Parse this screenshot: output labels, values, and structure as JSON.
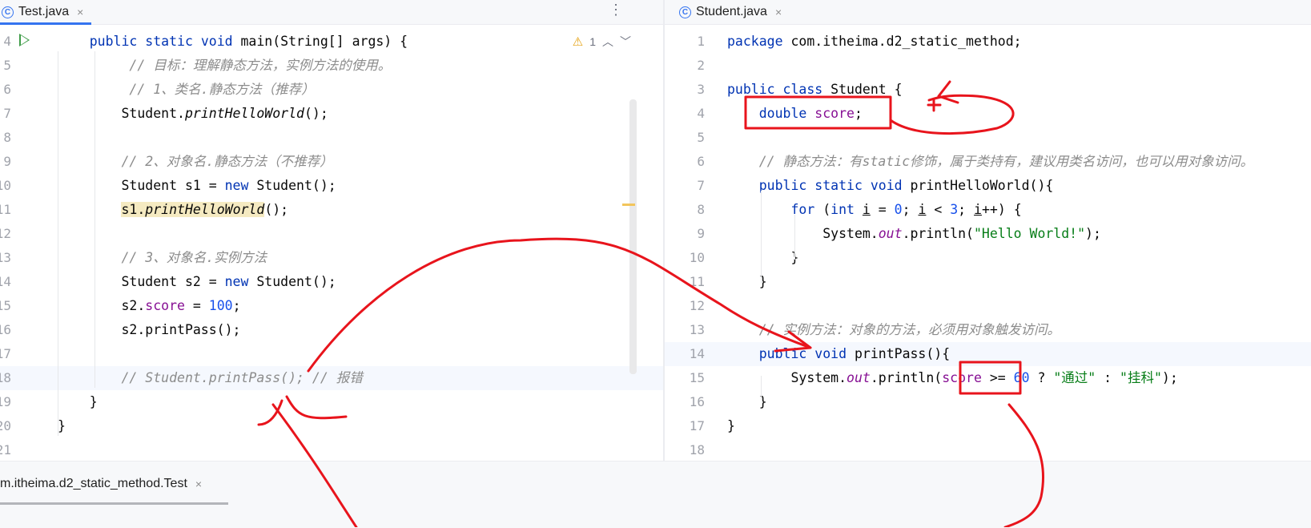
{
  "left_editor": {
    "tab_label": "Test.java",
    "class_icon": "C",
    "close_glyph": "×",
    "more_glyph": "⋮",
    "warning_count": "1",
    "warning_glyph": "⚠",
    "up_glyph": "︿",
    "down_glyph": "﹀",
    "lines": [
      {
        "num": "4",
        "html": "    <span class=\"kw\">public static void</span> main(String[] args) {"
      },
      {
        "num": "5",
        "html": "         <span class=\"cm\">// 目标：理解静态方法，实例方法的使用。</span>"
      },
      {
        "num": "6",
        "html": "         <span class=\"cm\">// 1、类名.静态方法（推荐）</span>"
      },
      {
        "num": "7",
        "html": "        Student.<span class=\"ital\">printHelloWorld</span>();"
      },
      {
        "num": "8",
        "html": ""
      },
      {
        "num": "9",
        "html": "        <span class=\"cm\">// 2、对象名.静态方法（不推荐）</span>"
      },
      {
        "num": "10",
        "html": "        Student s1 = <span class=\"kw\">new</span> Student();"
      },
      {
        "num": "11",
        "html": "        <span class=\"hl\">s1.<span class=\"ital\">printHelloWorld</span></span>();"
      },
      {
        "num": "12",
        "html": ""
      },
      {
        "num": "13",
        "html": "        <span class=\"cm\">// 3、对象名.实例方法</span>"
      },
      {
        "num": "14",
        "html": "        Student s2 = <span class=\"kw\">new</span> Student();"
      },
      {
        "num": "15",
        "html": "        s2.<span class=\"fld\">score</span> = <span class=\"num\">100</span>;"
      },
      {
        "num": "16",
        "html": "        s2.printPass();"
      },
      {
        "num": "17",
        "html": ""
      },
      {
        "num": "18",
        "html": "        <span class=\"cm\">// Student.printPass(); // 报错</span>"
      },
      {
        "num": "19",
        "html": "    }"
      },
      {
        "num": "20",
        "html": "}"
      },
      {
        "num": "21",
        "html": ""
      }
    ]
  },
  "right_editor": {
    "tab_label": "Student.java",
    "class_icon": "C",
    "close_glyph": "×",
    "lines": [
      {
        "num": "1",
        "html": "<span class=\"kw\">package</span> com.itheima.d2_static_method;"
      },
      {
        "num": "2",
        "html": ""
      },
      {
        "num": "3",
        "html": "<span class=\"kw\">public class</span> Student {"
      },
      {
        "num": "4",
        "html": "    <span class=\"kw\">double</span> <span class=\"fld\">score</span>;"
      },
      {
        "num": "5",
        "html": ""
      },
      {
        "num": "6",
        "html": "    <span class=\"cm\">// 静态方法：有static修饰，属于类持有，建议用类名访问，也可以用对象访问。</span>"
      },
      {
        "num": "7",
        "html": "    <span class=\"kw\">public static void</span> printHelloWorld(){"
      },
      {
        "num": "8",
        "html": "        <span class=\"kw\">for</span> (<span class=\"kw\">int</span> <u>i</u> = <span class=\"num\">0</span>; <u>i</u> &lt; <span class=\"num\">3</span>; <u>i</u>++) {"
      },
      {
        "num": "9",
        "html": "            System.<span class=\"fld ital\">out</span>.println(<span class=\"str\">\"Hello World!\"</span>);"
      },
      {
        "num": "10",
        "html": "        }"
      },
      {
        "num": "11",
        "html": "    }"
      },
      {
        "num": "12",
        "html": ""
      },
      {
        "num": "13",
        "html": "    <span class=\"cm\">// 实例方法：对象的方法，必须用对象触发访问。</span>"
      },
      {
        "num": "14",
        "html": "    <span class=\"kw\">public void</span> printPass(){"
      },
      {
        "num": "15",
        "html": "        System.<span class=\"fld ital\">out</span>.println(<span class=\"fld\">score</span> &gt;= <span class=\"num\">60</span> ? <span class=\"str\">\"通过\"</span> : <span class=\"str\">\"挂科\"</span>);"
      },
      {
        "num": "16",
        "html": "    }"
      },
      {
        "num": "17",
        "html": "}"
      },
      {
        "num": "18",
        "html": ""
      }
    ]
  },
  "bottom_panel": {
    "run_tab_label": "m.itheima.d2_static_method.Test",
    "close_glyph": "×"
  },
  "colors": {
    "annotation": "#e8141c",
    "keyword": "#0033b3",
    "comment": "#8c8c8c",
    "field": "#871094",
    "number": "#1750eb",
    "string": "#067d17"
  }
}
